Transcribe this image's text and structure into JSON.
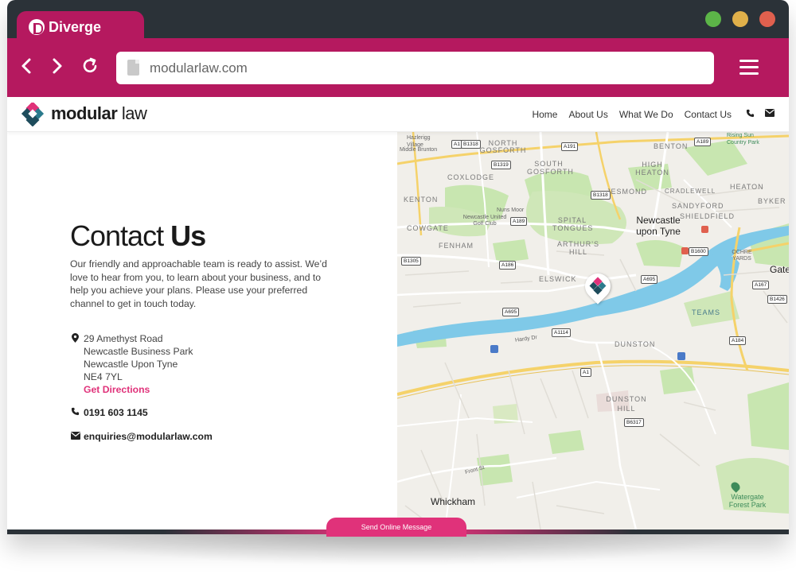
{
  "browser": {
    "tab_label": "Diverge",
    "url": "modularlaw.com",
    "colors": {
      "tab": "#b5195f",
      "titlebar": "#2b3238",
      "dot_green": "#5cb548",
      "dot_yellow": "#e0b04a",
      "dot_red": "#e0604e"
    }
  },
  "site": {
    "logo_bold": "modular",
    "logo_light": " law",
    "nav": [
      "Home",
      "About Us",
      "What We Do",
      "Contact Us"
    ],
    "accent": "#e0327a"
  },
  "contact": {
    "title_light": "Contact ",
    "title_bold": "Us",
    "intro": "Our friendly and approachable team is ready to assist. We’d love to hear from you, to learn about your business, and to help you achieve your plans. Please use your preferred channel to get in touch today.",
    "address_lines": [
      "29 Amethyst Road",
      "Newcastle Business Park",
      "Newcastle Upon Tyne",
      "NE4 7YL"
    ],
    "directions": "Get Directions",
    "phone": "0191 603 1145",
    "email": "enquiries@modularlaw.com",
    "send_button": "Send Online Message"
  },
  "map": {
    "labels": {
      "hazlerigg": "Hazlerigg Village",
      "middle_brunton": "Middle Brunton",
      "north_gosforth": "NORTH GOSFORTH",
      "benton": "BENTON",
      "rising_sun": "Rising Sun Country Park",
      "south_gosforth": "SOUTH GOSFORTH",
      "high_heaton": "HIGH HEATON",
      "coxlodge": "COXLODGE",
      "jesmond": "JESMOND",
      "cradlewell": "CRADLEWELL",
      "heaton": "HEATON",
      "kenton": "KENTON",
      "sandyford": "SANDYFORD",
      "byker": "BYKER",
      "nuns_moor": "Nuns Moor",
      "golf_club": "Newcastle United Golf Club",
      "cowgate": "COWGATE",
      "spital": "SPITAL TONGUES",
      "newcastle": "Newcastle upon Tyne",
      "shieldfield": "SHIELDFIELD",
      "fenham": "FENHAM",
      "arthurs_hill": "ARTHUR'S HILL",
      "ochre": "OCHRE YARDS",
      "gateshead": "Gatesh",
      "elswick": "ELSWICK",
      "teams": "TEAMS",
      "hardy_dr": "Hardy Dr",
      "dunston": "DUNSTON",
      "dunston_hill": "DUNSTON HILL",
      "front_st": "Front St",
      "watergate": "Watergate Forest Park",
      "whickham": "Whickham"
    },
    "roads": {
      "a1_n": "A1",
      "b1318_n": "B1318",
      "a191": "A191",
      "a189_n": "A189",
      "b1319": "B1319",
      "b1318": "B1318",
      "a189": "A189",
      "a186": "A186",
      "b1305": "B1305",
      "b1600": "B1600",
      "a695": "A695",
      "a695_w": "A695",
      "a1114": "A1114",
      "a1": "A1",
      "b6317": "B6317",
      "a184": "A184",
      "a167": "A167",
      "b1426": "B1426"
    }
  }
}
